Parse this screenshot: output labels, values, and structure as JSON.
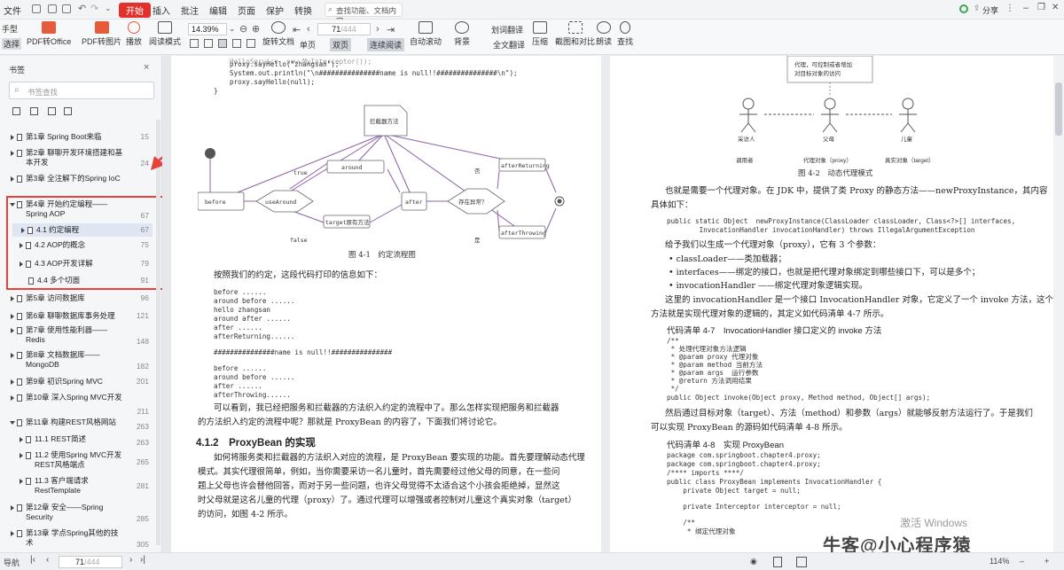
{
  "menu": {
    "file": "文件",
    "tabs": [
      "开始",
      "插入",
      "批注",
      "编辑",
      "页面",
      "保护",
      "转换"
    ],
    "search_placeholder": "查找功能、文档内容",
    "share": "分享"
  },
  "toolbar": {
    "hand": "手型",
    "select": "选择",
    "pdf_office": "PDF转Office",
    "pdf_image": "PDF转图片",
    "play": "播放",
    "read_mode": "阅读模式",
    "zoom": "14.39%",
    "rotate": "旋转文档",
    "single": "单页",
    "double": "双页",
    "continuous": "连续阅读",
    "page_input": "71",
    "page_total": "/444",
    "auto_scroll": "自动滚动",
    "background": "背景",
    "translate": "划词翻译",
    "full_translate": "全文翻译",
    "compress": "压缩",
    "screenshot": "截图和对比",
    "read_aloud": "朗读",
    "find": "查找"
  },
  "sidebar": {
    "title": "书签",
    "search_placeholder": "书签查找",
    "items": [
      {
        "label": "第1章 Spring Boot来临",
        "page": "15"
      },
      {
        "label": "第2章 聊聊开发环境搭建和基本开发",
        "page": "24"
      },
      {
        "label": "第3章 全注解下的Spring IoC",
        "page": ""
      },
      {
        "label": "第4章 开始约定编程——Spring AOP",
        "page": "67"
      },
      {
        "label": "4.1 约定编程",
        "page": "67"
      },
      {
        "label": "4.2 AOP的概念",
        "page": "75"
      },
      {
        "label": "4.3 AOP开发详解",
        "page": "79"
      },
      {
        "label": "4.4 多个切面",
        "page": "91"
      },
      {
        "label": "第5章 访问数据库",
        "page": "96"
      },
      {
        "label": "第6章 聊聊数据库事务处理",
        "page": "121"
      },
      {
        "label": "第7章 使用性能利器——Redis",
        "page": "148"
      },
      {
        "label": "第8章 文档数据库——MongoDB",
        "page": "182"
      },
      {
        "label": "第9章 初识Spring MVC",
        "page": "201"
      },
      {
        "label": "第10章 深入Spring MVC开发",
        "page": "211"
      },
      {
        "label": "第11章 构建REST风格网站",
        "page": "263"
      },
      {
        "label": "11.1 REST简述",
        "page": "263"
      },
      {
        "label": "11.2 使用Spring MVC开发REST风格端点",
        "page": "265"
      },
      {
        "label": "11.3 客户端请求RestTemplate",
        "page": "281"
      },
      {
        "label": "第12章 安全——Spring Security",
        "page": "285"
      },
      {
        "label": "第13章 学点Spring其他的技术",
        "page": "305"
      }
    ]
  },
  "page1": {
    "code_top": [
      "proxy.sayHello(\"zhangsan\");",
      "System.out.println(\"\\n###############name is null!!###############\\n\");",
      "proxy.sayHello(null);",
      "}"
    ],
    "diagram": {
      "interceptor": "拦截器方法",
      "before": "before",
      "useAround": "useAround",
      "around": "around",
      "target": "target原有方法",
      "after": "after",
      "exception": "存在异常？",
      "afterReturning": "afterReturning",
      "afterThrowing": "afterThrowing",
      "true": "true",
      "false": "false",
      "no": "否",
      "yes": "是"
    },
    "fig_caption": "图 4-1　约定流程图",
    "intro": "按照我们的约定，这段代码打印的信息如下：",
    "output": [
      "before ......",
      "around before ......",
      "hello zhangsan",
      "around after ......",
      "after ......",
      "afterReturning......",
      "",
      "###############name is null!!###############",
      "",
      "before ......",
      "around before ......",
      "after ......",
      "afterThrowing......"
    ],
    "para1": [
      "可以看到，我已经把服务和拦截器的方法织入约定的流程中了。那么怎样实现把服务和拦截器",
      "的方法织入约定的流程中呢？那就是 ProxyBean 的内容了，下面我们将讨论它。"
    ],
    "section": "4.1.2　ProxyBean 的实现",
    "para2": [
      "如何将服务类和拦截器的方法织入对应的流程，是 ProxyBean 要实现的功能。首先要理解动态代理",
      "模式。其实代理很简单，例如，当你需要采访一名儿童时，首先需要经过他父母的同意，在一些问",
      "题上父母也许会替他回答，而对于另一些问题，也许父母觉得不太适合这个小孩会拒绝掉，显然这",
      "时父母就是这名儿童的代理（proxy）了。通过代理可以增强或者控制对儿童这个真实对象（target）",
      "的访问，如图 4-2 所示。"
    ]
  },
  "page2": {
    "note": [
      "代理，可控制或者增加",
      "对目标对象的访问"
    ],
    "visitor": "采访人",
    "parent": "父母",
    "child": "儿童",
    "caller": "调用者",
    "proxy_label": "代理对象（proxy）",
    "target_label": "真实对象（target）",
    "fig_caption": "图 4-2　动态代理模式",
    "para1": [
      "也就是需要一个代理对象。在 JDK 中，提供了类 Proxy 的静态方法——newProxyInstance，其内容",
      "具体如下："
    ],
    "code1": [
      "public static Object  newProxyInstance(ClassLoader classLoader, Class<?>[] interfaces,",
      "        InvocationHandler invocationHandler) throws IllegalArgumentException"
    ],
    "para2": "给予我们以生成一个代理对象（proxy），它有 3 个参数：",
    "bullets": [
      "classLoader——类加载器；",
      "interfaces——绑定的接口，也就是把代理对象绑定到哪些接口下，可以是多个；",
      "invocationHandler ——绑定代理对象逻辑实现。"
    ],
    "para3": [
      "这里的 invocationHandler 是一个接口 InvocationHandler 对象，它定义了一个 invoke 方法，这个",
      "方法就是实现代理对象的逻辑的，其定义如代码清单 4-7 所示。"
    ],
    "listing1": "代码清单 4-7　InvocationHandler 接口定义的 invoke 方法",
    "code2": [
      "/**",
      " * 处理代理对象方法逻辑",
      " * @param proxy 代理对象",
      " * @param method 当前方法",
      " * @param args  运行参数",
      " * @return 方法调用结果",
      " */",
      "public Object invoke(Object proxy, Method method, Object[] args);"
    ],
    "para4": [
      "然后通过目标对象（target）、方法（method）和参数（args）就能够反射方法运行了。于是我们",
      "可以实现 ProxyBean 的源码如代码清单 4-8 所示。"
    ],
    "listing2": "代码清单 4-8　实现 ProxyBean",
    "code3": [
      "package com.springboot.chapter4.proxy;",
      "package com.springboot.chapter4.proxy;",
      "/**** imports ****/",
      "public class ProxyBean implements InvocationHandler {",
      "    private Object target = null;",
      "",
      "    private Interceptor interceptor = null;",
      "",
      "    /**",
      "     * 绑定代理对象"
    ],
    "watermark": "激活 Windows",
    "brand": "牛客@小心程序猿"
  },
  "status": {
    "page": "71",
    "total": "/444",
    "zoom": "114%"
  },
  "colors": {
    "accent": "#e0312c",
    "highlight_box": "#e8413c",
    "sidebar_sel": "#dfe6f2",
    "diagram_line": "#8e5fa6"
  }
}
